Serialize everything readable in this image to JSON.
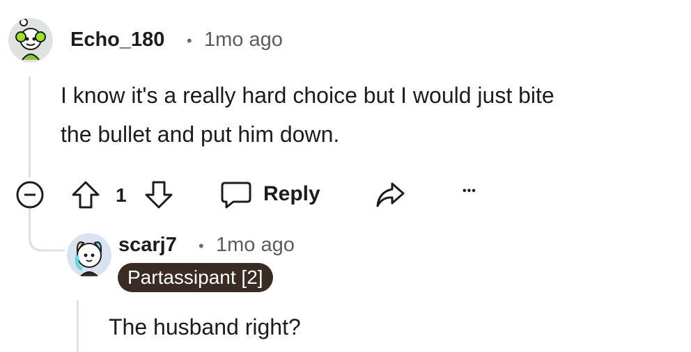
{
  "comments": [
    {
      "username": "Echo_180",
      "separator": "•",
      "time": "1mo ago",
      "body_line1": "I know it's a really hard choice but I would just bite",
      "body_line2": "the bullet and put him down.",
      "votes": "1",
      "reply_label": "Reply",
      "more_label": "•••",
      "avatar_icon": "snoo-headphones-avatar"
    },
    {
      "username": "scarj7",
      "separator": "•",
      "time": "1mo ago",
      "flair": "Partassipant [2]",
      "body": "The husband right?",
      "avatar_icon": "snoo-cat-avatar"
    }
  ],
  "colors": {
    "flair_bg": "#3a2b25",
    "thread_line": "#e0e0e0",
    "text": "#1c1c1c",
    "meta": "#5c5c5c"
  }
}
